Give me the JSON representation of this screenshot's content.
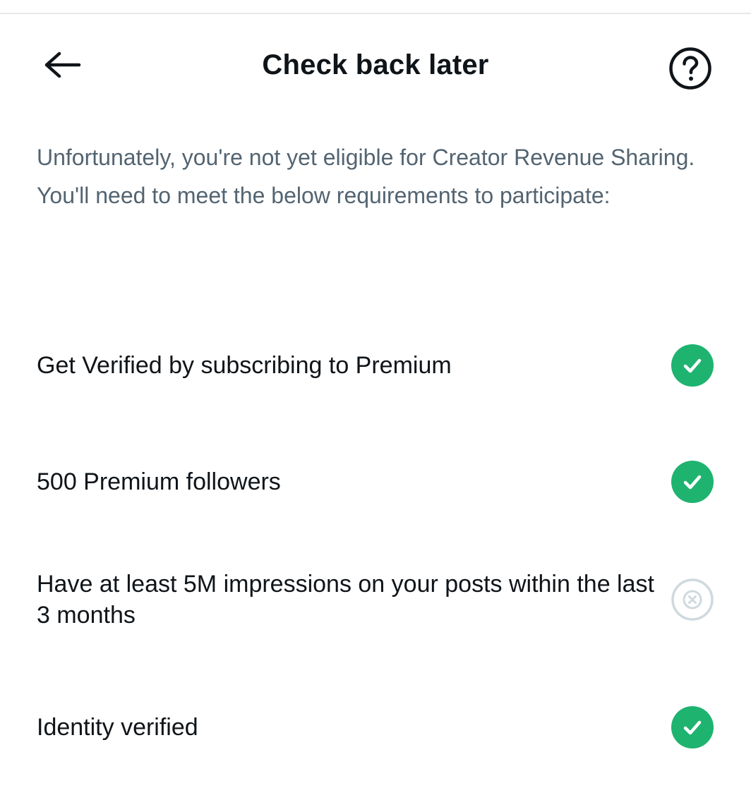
{
  "header": {
    "title": "Check back later",
    "back_icon": "arrow-left-icon",
    "help_icon": "question-circle-icon"
  },
  "intro": {
    "text": "Unfortunately, you're not yet eligible for Creator Revenue Sharing. You'll need to meet the below requirements to participate:"
  },
  "requirements": [
    {
      "label": "Get Verified by subscribing to Premium",
      "status": "met",
      "icon": "check-circle-icon"
    },
    {
      "label": "500 Premium followers",
      "status": "met",
      "icon": "check-circle-icon"
    },
    {
      "label": "Have at least 5M impressions on your posts within the last 3 months",
      "status": "not-met",
      "icon": "x-circle-icon"
    },
    {
      "label": "Identity verified",
      "status": "met",
      "icon": "check-circle-icon"
    }
  ],
  "colors": {
    "met": "#1fb370",
    "not_met": "#cfd9de",
    "text_primary": "#0f1419",
    "text_secondary": "#536471"
  }
}
